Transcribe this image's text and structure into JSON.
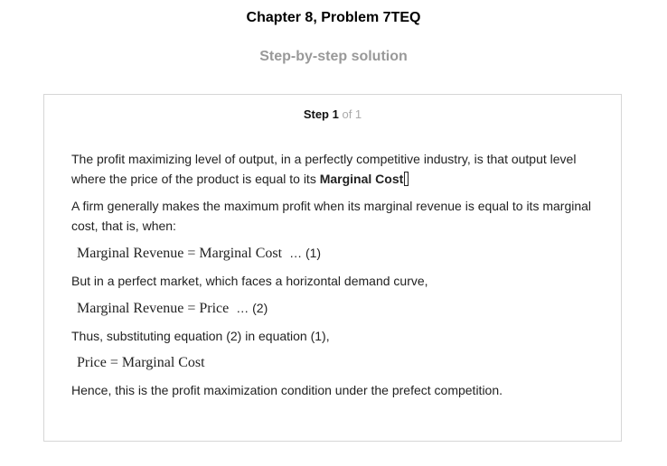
{
  "header": {
    "title": "Chapter 8, Problem 7TEQ",
    "subtitle": "Step-by-step solution"
  },
  "step": {
    "label": "Step 1",
    "of": "of 1"
  },
  "content": {
    "p1_text": "The profit maximizing level of output, in a perfectly competitive industry, is that output level where the price of the product is equal to its ",
    "p1_bold": "Marginal Cost",
    "p2": "A firm generally makes the maximum profit when its marginal revenue is equal to its marginal cost, that is, when:",
    "eq1": "Marginal Revenue = Marginal Cost",
    "eq1_ref": "… (1)",
    "p3": "But in a perfect market, which faces a horizontal demand curve,",
    "eq2": "Marginal Revenue = Price",
    "eq2_ref": "… (2)",
    "p4": "Thus, substituting equation (2) in equation (1),",
    "eq3": "Price = Marginal Cost",
    "p5": "Hence, this is the profit maximization condition under the prefect competition."
  }
}
